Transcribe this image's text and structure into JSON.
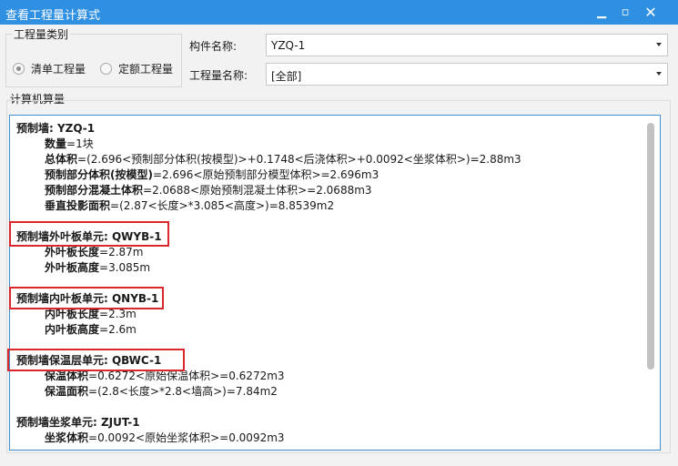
{
  "window": {
    "title": "查看工程量计算式",
    "minimize": "▁",
    "maximize": "▫",
    "close": "✕"
  },
  "category": {
    "title": "工程量类别",
    "options": [
      "清单工程量",
      "定额工程量"
    ],
    "selected": "清单工程量"
  },
  "component": {
    "label": "构件名称:",
    "value": "YZQ-1"
  },
  "quantity": {
    "label": "工程量名称:",
    "value": "[全部]"
  },
  "calc": {
    "title": "计算机算量",
    "lines": [
      {
        "type": "head",
        "text": "预制墙: YZQ-1"
      },
      {
        "type": "sub",
        "key": "数量",
        "rest": "=1块"
      },
      {
        "type": "sub",
        "key": "总体积",
        "rest": "=(2.696<预制部分体积(按模型)>+0.1748<后浇体积>+0.0092<坐浆体积>)=2.88m3"
      },
      {
        "type": "sub",
        "key": "预制部分体积(按模型)",
        "rest": "=2.696<原始预制部分模型体积>=2.696m3"
      },
      {
        "type": "sub",
        "key": "预制部分混凝土体积",
        "rest": "=2.0688<原始预制混凝土体积>=2.0688m3"
      },
      {
        "type": "sub",
        "key": "垂直投影面积",
        "rest": "=(2.87<长度>*3.085<高度>)=8.8539m2"
      },
      {
        "type": "head",
        "text": "预制墙外叶板单元: QWYB-1"
      },
      {
        "type": "sub",
        "key": "外叶板长度",
        "rest": "=2.87m"
      },
      {
        "type": "sub",
        "key": "外叶板高度",
        "rest": "=3.085m"
      },
      {
        "type": "head",
        "text": "预制墙内叶板单元: QNYB-1"
      },
      {
        "type": "sub",
        "key": "内叶板长度",
        "rest": "=2.3m"
      },
      {
        "type": "sub",
        "key": "内叶板高度",
        "rest": "=2.6m"
      },
      {
        "type": "head",
        "text": "预制墙保温层单元: QBWC-1"
      },
      {
        "type": "sub",
        "key": "保温体积",
        "rest": "=0.6272<原始保温体积>=0.6272m3"
      },
      {
        "type": "sub",
        "key": "保温面积",
        "rest": "=(2.8<长度>*2.8<墙高>)=7.84m2"
      },
      {
        "type": "head",
        "text": "预制墙坐浆单元: ZJUT-1"
      },
      {
        "type": "sub",
        "key": "坐浆体积",
        "rest": "=0.0092<原始坐浆体积>=0.0092m3"
      }
    ]
  },
  "colors": {
    "titlebar": "#2f8fe0",
    "highlight": "#d9272b",
    "textbox_border": "#3f8fd0"
  }
}
